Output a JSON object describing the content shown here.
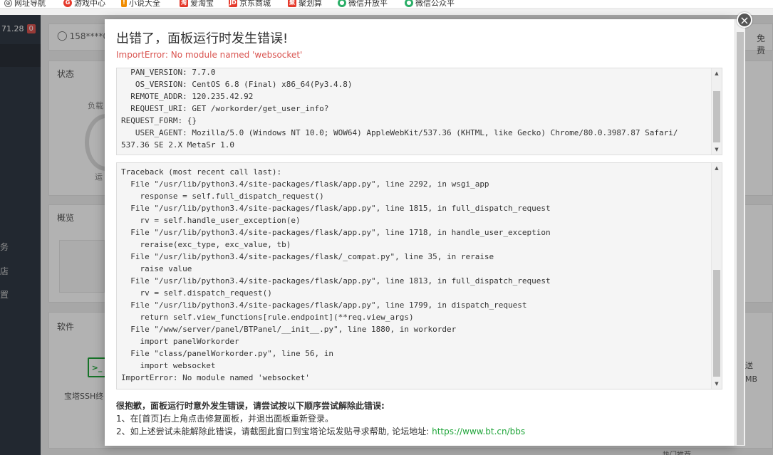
{
  "bookmarks": [
    {
      "label": "网址导航",
      "icon": "globe-icon",
      "color": "#666666"
    },
    {
      "label": "游戏中心",
      "icon": "game-icon",
      "color": "#e5392b"
    },
    {
      "label": "小说大全",
      "icon": "book-icon",
      "color": "#f08c00"
    },
    {
      "label": "爱淘宝",
      "icon": "taobao-icon",
      "color": "#e5392b"
    },
    {
      "label": "京东商城",
      "icon": "jd-icon",
      "color": "#e5392b"
    },
    {
      "label": "聚划算",
      "icon": "juhuasuan-icon",
      "color": "#e5392b"
    },
    {
      "label": "微信开放平",
      "icon": "wechat-icon",
      "color": "#2aae67"
    },
    {
      "label": "微信公众平",
      "icon": "wechat-icon",
      "color": "#2aae67"
    }
  ],
  "background": {
    "ip_fragment": "71.28",
    "badge": "0",
    "user": "158****0",
    "free_fragment": "免费",
    "nav": [
      "务",
      "店",
      "置"
    ],
    "cards": {
      "status": "状态",
      "overview": "概览",
      "software": "软件"
    },
    "load_fragment": "负载",
    "run_fragment": "运",
    "ssh_label": "宝塔SSH终",
    "right_fragment_1": "送",
    "right_fragment_2": "MB",
    "footer": "热门推荐"
  },
  "modal": {
    "title": "出错了，面板运行时发生错误!",
    "subtitle": "ImportError: No module named 'websocket'",
    "env_lines": [
      "  PAN_VERSION: 7.7.0",
      "   OS_VERSION: CentOS 6.8 (Final) x86_64(Py3.4.8)",
      "  REMOTE_ADDR: 120.235.42.92",
      "  REQUEST_URI: GET /workorder/get_user_info?",
      "REQUEST_FORM: {}",
      "   USER_AGENT: Mozilla/5.0 (Windows NT 10.0; WOW64) AppleWebKit/537.36 (KHTML, like Gecko) Chrome/80.0.3987.87 Safari/",
      "537.36 SE 2.X MetaSr 1.0"
    ],
    "traceback_lines": [
      "Traceback (most recent call last):",
      "  File \"/usr/lib/python3.4/site-packages/flask/app.py\", line 2292, in wsgi_app",
      "    response = self.full_dispatch_request()",
      "  File \"/usr/lib/python3.4/site-packages/flask/app.py\", line 1815, in full_dispatch_request",
      "    rv = self.handle_user_exception(e)",
      "  File \"/usr/lib/python3.4/site-packages/flask/app.py\", line 1718, in handle_user_exception",
      "    reraise(exc_type, exc_value, tb)",
      "  File \"/usr/lib/python3.4/site-packages/flask/_compat.py\", line 35, in reraise",
      "    raise value",
      "  File \"/usr/lib/python3.4/site-packages/flask/app.py\", line 1813, in full_dispatch_request",
      "    rv = self.dispatch_request()",
      "  File \"/usr/lib/python3.4/site-packages/flask/app.py\", line 1799, in dispatch_request",
      "    return self.view_functions[rule.endpoint](**req.view_args)",
      "  File \"/www/server/panel/BTPanel/__init__.py\", line 1880, in workorder",
      "    import panelWorkorder",
      "  File \"class/panelWorkorder.py\", line 56, in",
      "    import websocket",
      "ImportError: No module named 'websocket'"
    ],
    "help_title": "很抱歉，面板运行时意外发生错误，请尝试按以下顺序尝试解除此错误:",
    "help_1": "1、在[首页]右上角点击修复面板，并退出面板重新登录。",
    "help_2_prefix": "2、如上述尝试未能解除此错误，请截图此窗口到宝塔论坛发贴寻求帮助, 论坛地址: ",
    "help_2_link": "https://www.bt.cn/bbs",
    "close": "×"
  },
  "colors": {
    "error": "#d9534f",
    "link": "#20a53a",
    "sidebar": "#323a45"
  }
}
